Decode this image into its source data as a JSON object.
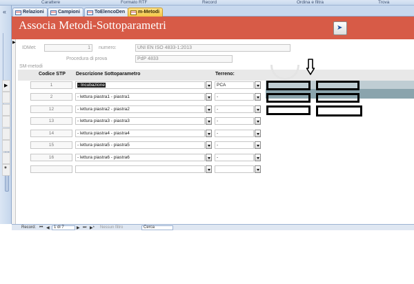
{
  "ribbon": {
    "groups": [
      "Carattere",
      "Formato RTF",
      "Record",
      "Ordina e filtra",
      "Trova"
    ]
  },
  "navpane": {
    "collapse_glyph": "«"
  },
  "tabs": [
    {
      "label": "Relazioni",
      "active": false
    },
    {
      "label": "Campioni",
      "active": false
    },
    {
      "label": "ToElencoDen",
      "active": false
    },
    {
      "label": "m-Metodi",
      "active": true
    }
  ],
  "form": {
    "title": "Associa Metodi-Sottoparametri",
    "header_button_icon": "open-form-icon",
    "header_color": "#d75b47"
  },
  "record": {
    "idmet_label": "IDMet:",
    "idmet_value": "1",
    "numero_label": "numero:",
    "numero_value": "UNI EN ISO 4833-1:2013",
    "procedura_label": "Procedura di prova",
    "procedura_value": "PdP 4833",
    "sm_metodi_label": "SM-metodi"
  },
  "subform": {
    "columns": [
      "Codice STP",
      "Descrizione Sottoparametro",
      "Terreno:"
    ],
    "rows": [
      {
        "code": "1",
        "descrizione": "- Incubazione",
        "terreno": "PCA",
        "current": true
      },
      {
        "code": "2",
        "descrizione": "- lettura piastra1 - piastra1",
        "terreno": "-",
        "current": false
      },
      {
        "code": "12",
        "descrizione": "- lettura piastra2 - piastra2",
        "terreno": "-",
        "current": false
      },
      {
        "code": "13",
        "descrizione": "- lettura piastra3 - piastra3",
        "terreno": "-",
        "current": false
      },
      {
        "code": "14",
        "descrizione": "- lettura piastra4 - piastra4",
        "terreno": "-",
        "current": false
      },
      {
        "code": "15",
        "descrizione": "- lettura piastra5 - piastra5",
        "terreno": "-",
        "current": false
      },
      {
        "code": "16",
        "descrizione": "- lettura piastra6 - piastra6",
        "terreno": "-",
        "current": false
      }
    ],
    "new_record_glyph": "*"
  },
  "navbar": {
    "record_label": "Record:",
    "position": "1 di 7",
    "first_glyph": "⏮",
    "prev_glyph": "◀",
    "next_glyph": "▶",
    "last_glyph": "⏭",
    "new_glyph": "▶*",
    "filter_label": "Nessun filtro",
    "search_label": "Cerca"
  }
}
